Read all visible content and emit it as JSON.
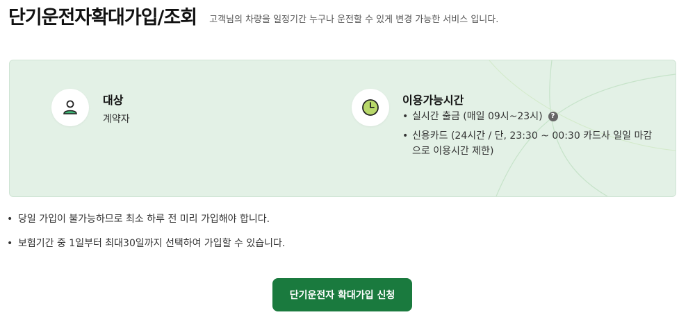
{
  "header": {
    "title": "단기운전자확대가입/조회",
    "description": "고객님의 차량을 일정기간 누구나 운전할 수 있게 변경 가능한 서비스 입니다."
  },
  "info": {
    "target": {
      "icon": "person-icon",
      "title": "대상",
      "text": "계약자"
    },
    "hours": {
      "icon": "clock-icon",
      "title": "이용가능시간",
      "items": [
        "실시간 출금 (매일 09시~23시)",
        "신용카드 (24시간 / 단, 23:30 ~ 00:30 카드사 일일 마감으로 이용시간 제한)"
      ],
      "help_icon": "?"
    }
  },
  "notes": [
    "당일 가입이 불가능하므로 최소 하루 전 미리 가입해야 합니다.",
    "보험기간 중 1일부터 최대30일까지 선택하여 가입할 수 있습니다."
  ],
  "apply_button": "단기운전자 확대가입 신청",
  "colors": {
    "accent": "#1a7a3e",
    "panel_bg": "#e3f1e6"
  }
}
